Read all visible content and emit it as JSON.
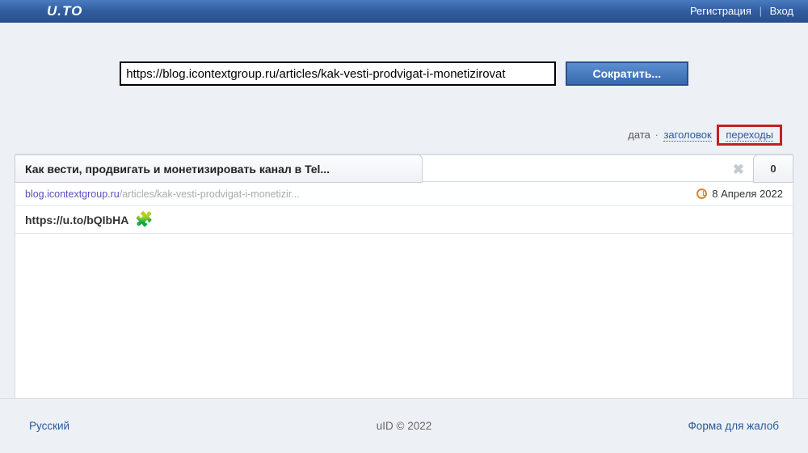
{
  "header": {
    "logo": "U.TO",
    "register": "Регистрация",
    "login": "Вход"
  },
  "shortener": {
    "url_value": "https://blog.icontextgroup.ru/articles/kak-vesti-prodvigat-i-monetizirovat",
    "button_label": "Сократить..."
  },
  "sort": {
    "date_label": "дата",
    "title_label": "заголовок",
    "visits_label": "переходы"
  },
  "entry": {
    "title": "Как вести, продвигать и монетизировать канал в Tel...",
    "source_domain": "blog.icontextgroup.ru",
    "source_path": "/articles/kak-vesti-prodvigat-i-monetizir...",
    "date": "8 Апреля 2022",
    "short_url": "https://u.to/bQIbHA",
    "visits_count": "0"
  },
  "footer": {
    "language": "Русский",
    "copyright": "uID © 2022",
    "complaints": "Форма для жалоб"
  }
}
